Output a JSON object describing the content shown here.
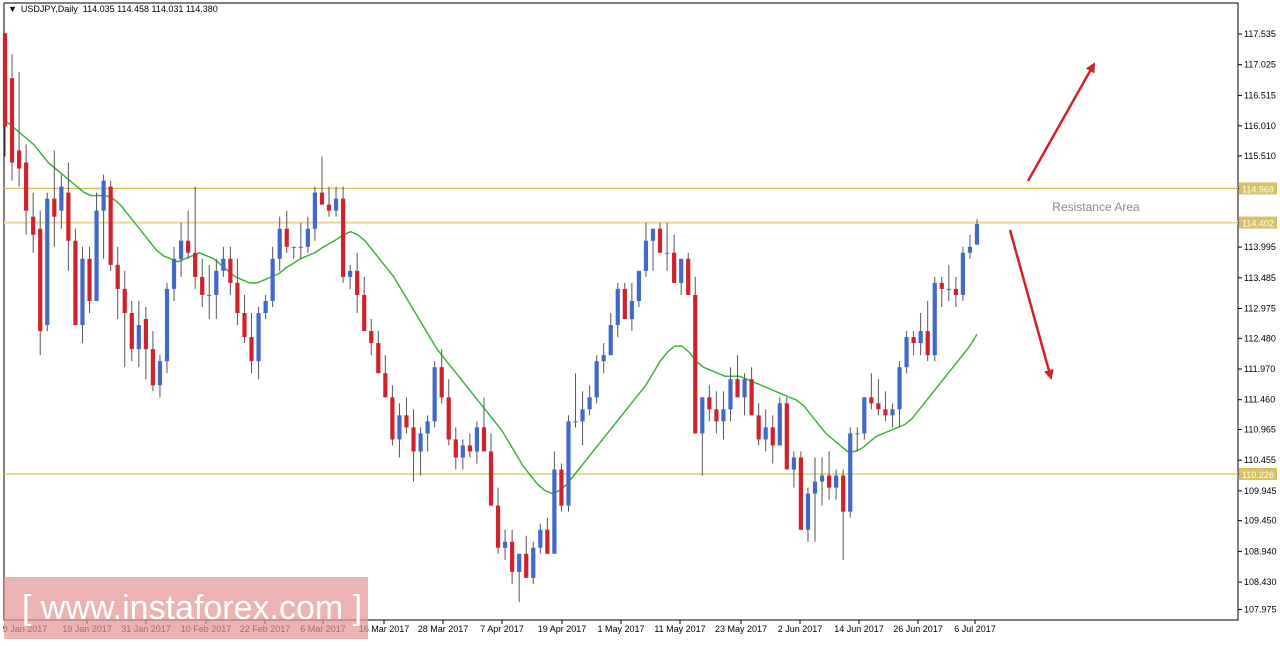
{
  "header": {
    "symbol_timeframe": "USDJPY,Daily",
    "ohlc": "114.035 114.458 114.031 114.380",
    "dropdown_icon": "triangle-down-icon"
  },
  "watermark": "[ www.instaforex.com ]",
  "chart_data": {
    "type": "candlestick",
    "title": "USDJPY,Daily",
    "ylim": [
      107.8,
      118.05
    ],
    "y_ticks": [
      "117.535",
      "117.025",
      "116.515",
      "116.010",
      "115.510",
      "114.969",
      "114.402",
      "113.995",
      "113.485",
      "112.975",
      "112.480",
      "111.970",
      "111.460",
      "110.965",
      "110.455",
      "110.226",
      "109.945",
      "109.450",
      "108.940",
      "108.430",
      "107.975"
    ],
    "x_tick_labels": [
      "9 Jan 2017",
      "19 Jan 2017",
      "31 Jan 2017",
      "10 Feb 2017",
      "22 Feb 2017",
      "6 Mar 2017",
      "16 Mar 2017",
      "28 Mar 2017",
      "7 Apr 2017",
      "19 Apr 2017",
      "1 May 2017",
      "11 May 2017",
      "23 May 2017",
      "2 Jun 2017",
      "14 Jun 2017",
      "26 Jun 2017",
      "6 Jul 2017"
    ],
    "horizontal_levels": [
      {
        "value": 114.969,
        "label": "114.969",
        "color": "#d9c061"
      },
      {
        "value": 114.402,
        "label": "114.402",
        "color": "#d9c061"
      },
      {
        "value": 110.226,
        "label": "110.226",
        "color": "#d9c061"
      }
    ],
    "annotation": {
      "text": "Resistance Area",
      "color": "#8a8a8a"
    },
    "colors": {
      "bull": "#4169c8",
      "bear": "#d0222b",
      "ma": "#3cb43c",
      "arrow": "#d0222b",
      "grid": "#000000"
    },
    "arrows": [
      "up-right",
      "down-right"
    ],
    "candles": [
      {
        "o": 117.55,
        "h": 117.55,
        "l": 115.5,
        "c": 116.0
      },
      {
        "o": 116.8,
        "h": 117.2,
        "l": 115.1,
        "c": 115.4
      },
      {
        "o": 115.6,
        "h": 116.9,
        "l": 115.0,
        "c": 115.3
      },
      {
        "o": 115.4,
        "h": 115.7,
        "l": 114.2,
        "c": 114.6
      },
      {
        "o": 114.5,
        "h": 114.9,
        "l": 113.9,
        "c": 114.2
      },
      {
        "o": 114.3,
        "h": 114.6,
        "l": 112.2,
        "c": 112.6
      },
      {
        "o": 112.7,
        "h": 114.9,
        "l": 112.6,
        "c": 114.8
      },
      {
        "o": 114.8,
        "h": 115.6,
        "l": 114.0,
        "c": 114.5
      },
      {
        "o": 114.6,
        "h": 115.2,
        "l": 114.3,
        "c": 115.0
      },
      {
        "o": 114.9,
        "h": 115.4,
        "l": 113.6,
        "c": 114.1
      },
      {
        "o": 114.1,
        "h": 114.3,
        "l": 112.7,
        "c": 112.7
      },
      {
        "o": 112.7,
        "h": 114.0,
        "l": 112.4,
        "c": 113.8
      },
      {
        "o": 113.8,
        "h": 114.0,
        "l": 112.9,
        "c": 113.1
      },
      {
        "o": 113.1,
        "h": 114.9,
        "l": 113.1,
        "c": 114.6
      },
      {
        "o": 114.6,
        "h": 115.2,
        "l": 113.8,
        "c": 115.1
      },
      {
        "o": 115.0,
        "h": 115.1,
        "l": 113.6,
        "c": 113.7
      },
      {
        "o": 113.7,
        "h": 114.0,
        "l": 112.8,
        "c": 113.3
      },
      {
        "o": 113.3,
        "h": 113.6,
        "l": 112.0,
        "c": 112.9
      },
      {
        "o": 112.9,
        "h": 113.1,
        "l": 112.1,
        "c": 112.3
      },
      {
        "o": 112.3,
        "h": 113.1,
        "l": 112.0,
        "c": 112.7
      },
      {
        "o": 112.8,
        "h": 113.0,
        "l": 111.8,
        "c": 112.3
      },
      {
        "o": 112.3,
        "h": 112.6,
        "l": 111.6,
        "c": 111.7
      },
      {
        "o": 111.7,
        "h": 112.2,
        "l": 111.5,
        "c": 112.1
      },
      {
        "o": 112.1,
        "h": 113.4,
        "l": 111.9,
        "c": 113.3
      },
      {
        "o": 113.3,
        "h": 114.0,
        "l": 113.1,
        "c": 113.8
      },
      {
        "o": 113.8,
        "h": 114.4,
        "l": 113.5,
        "c": 114.1
      },
      {
        "o": 114.1,
        "h": 114.6,
        "l": 113.8,
        "c": 113.9
      },
      {
        "o": 113.9,
        "h": 115.0,
        "l": 113.3,
        "c": 113.5
      },
      {
        "o": 113.5,
        "h": 113.8,
        "l": 113.0,
        "c": 113.2
      },
      {
        "o": 113.2,
        "h": 113.7,
        "l": 112.8,
        "c": 113.2
      },
      {
        "o": 113.2,
        "h": 113.8,
        "l": 112.8,
        "c": 113.6
      },
      {
        "o": 113.6,
        "h": 114.0,
        "l": 113.5,
        "c": 113.8
      },
      {
        "o": 113.8,
        "h": 114.0,
        "l": 113.2,
        "c": 113.4
      },
      {
        "o": 113.4,
        "h": 113.8,
        "l": 112.7,
        "c": 112.9
      },
      {
        "o": 112.9,
        "h": 113.2,
        "l": 112.4,
        "c": 112.5
      },
      {
        "o": 112.5,
        "h": 112.9,
        "l": 111.9,
        "c": 112.1
      },
      {
        "o": 112.1,
        "h": 113.0,
        "l": 111.8,
        "c": 112.9
      },
      {
        "o": 112.9,
        "h": 113.2,
        "l": 112.8,
        "c": 113.1
      },
      {
        "o": 113.1,
        "h": 114.0,
        "l": 113.0,
        "c": 113.8
      },
      {
        "o": 113.8,
        "h": 114.5,
        "l": 113.6,
        "c": 114.3
      },
      {
        "o": 114.3,
        "h": 114.6,
        "l": 113.9,
        "c": 114.0
      },
      {
        "o": 114.0,
        "h": 114.0,
        "l": 113.8,
        "c": 114.0
      },
      {
        "o": 114.0,
        "h": 114.4,
        "l": 113.8,
        "c": 114.0
      },
      {
        "o": 114.0,
        "h": 114.5,
        "l": 113.9,
        "c": 114.3
      },
      {
        "o": 114.3,
        "h": 115.0,
        "l": 114.1,
        "c": 114.9
      },
      {
        "o": 114.9,
        "h": 115.5,
        "l": 114.8,
        "c": 114.7
      },
      {
        "o": 114.7,
        "h": 115.0,
        "l": 114.5,
        "c": 114.6
      },
      {
        "o": 114.6,
        "h": 115.0,
        "l": 114.5,
        "c": 114.8
      },
      {
        "o": 114.8,
        "h": 115.0,
        "l": 113.4,
        "c": 113.5
      },
      {
        "o": 113.5,
        "h": 113.7,
        "l": 113.3,
        "c": 113.6
      },
      {
        "o": 113.6,
        "h": 113.9,
        "l": 112.9,
        "c": 113.2
      },
      {
        "o": 113.2,
        "h": 113.5,
        "l": 112.6,
        "c": 112.6
      },
      {
        "o": 112.6,
        "h": 112.8,
        "l": 112.2,
        "c": 112.4
      },
      {
        "o": 112.4,
        "h": 112.6,
        "l": 111.9,
        "c": 111.9
      },
      {
        "o": 111.9,
        "h": 112.2,
        "l": 111.5,
        "c": 111.5
      },
      {
        "o": 111.5,
        "h": 111.7,
        "l": 110.7,
        "c": 110.8
      },
      {
        "o": 110.8,
        "h": 111.4,
        "l": 110.5,
        "c": 111.2
      },
      {
        "o": 111.2,
        "h": 111.5,
        "l": 110.9,
        "c": 111.0
      },
      {
        "o": 111.0,
        "h": 111.3,
        "l": 110.1,
        "c": 110.6
      },
      {
        "o": 110.6,
        "h": 111.0,
        "l": 110.2,
        "c": 110.9
      },
      {
        "o": 110.9,
        "h": 111.2,
        "l": 110.6,
        "c": 111.1
      },
      {
        "o": 111.1,
        "h": 112.1,
        "l": 111.0,
        "c": 112.0
      },
      {
        "o": 112.0,
        "h": 112.3,
        "l": 111.4,
        "c": 111.5
      },
      {
        "o": 111.5,
        "h": 111.8,
        "l": 110.7,
        "c": 110.8
      },
      {
        "o": 110.8,
        "h": 111.0,
        "l": 110.3,
        "c": 110.5
      },
      {
        "o": 110.5,
        "h": 110.8,
        "l": 110.3,
        "c": 110.7
      },
      {
        "o": 110.7,
        "h": 110.9,
        "l": 110.5,
        "c": 110.6
      },
      {
        "o": 110.6,
        "h": 111.1,
        "l": 110.4,
        "c": 111.0
      },
      {
        "o": 111.0,
        "h": 111.5,
        "l": 110.9,
        "c": 110.6
      },
      {
        "o": 110.6,
        "h": 110.9,
        "l": 109.7,
        "c": 109.7
      },
      {
        "o": 109.7,
        "h": 110.0,
        "l": 108.9,
        "c": 109.0
      },
      {
        "o": 109.0,
        "h": 109.3,
        "l": 108.8,
        "c": 109.1
      },
      {
        "o": 109.1,
        "h": 109.3,
        "l": 108.4,
        "c": 108.6
      },
      {
        "o": 108.6,
        "h": 108.8,
        "l": 108.1,
        "c": 108.9
      },
      {
        "o": 108.9,
        "h": 109.2,
        "l": 108.5,
        "c": 108.5
      },
      {
        "o": 108.5,
        "h": 109.1,
        "l": 108.4,
        "c": 109.0
      },
      {
        "o": 109.0,
        "h": 109.4,
        "l": 108.9,
        "c": 109.3
      },
      {
        "o": 109.3,
        "h": 109.5,
        "l": 108.9,
        "c": 108.9
      },
      {
        "o": 108.9,
        "h": 110.6,
        "l": 108.9,
        "c": 110.3
      },
      {
        "o": 110.3,
        "h": 110.4,
        "l": 109.6,
        "c": 109.7
      },
      {
        "o": 109.7,
        "h": 111.2,
        "l": 109.6,
        "c": 111.1
      },
      {
        "o": 111.1,
        "h": 111.9,
        "l": 111.0,
        "c": 111.1
      },
      {
        "o": 111.1,
        "h": 111.6,
        "l": 110.7,
        "c": 111.3
      },
      {
        "o": 111.3,
        "h": 111.7,
        "l": 111.2,
        "c": 111.5
      },
      {
        "o": 111.5,
        "h": 112.2,
        "l": 111.4,
        "c": 112.1
      },
      {
        "o": 112.1,
        "h": 112.4,
        "l": 111.9,
        "c": 112.2
      },
      {
        "o": 112.2,
        "h": 112.9,
        "l": 112.2,
        "c": 112.7
      },
      {
        "o": 112.7,
        "h": 113.4,
        "l": 112.5,
        "c": 113.3
      },
      {
        "o": 113.3,
        "h": 113.4,
        "l": 112.8,
        "c": 112.8
      },
      {
        "o": 112.8,
        "h": 113.4,
        "l": 112.6,
        "c": 113.1
      },
      {
        "o": 113.1,
        "h": 113.6,
        "l": 113.0,
        "c": 113.6
      },
      {
        "o": 113.6,
        "h": 114.4,
        "l": 113.5,
        "c": 114.1
      },
      {
        "o": 114.1,
        "h": 114.3,
        "l": 113.6,
        "c": 114.3
      },
      {
        "o": 114.3,
        "h": 114.4,
        "l": 113.9,
        "c": 113.9
      },
      {
        "o": 113.9,
        "h": 114.4,
        "l": 113.6,
        "c": 113.9
      },
      {
        "o": 113.9,
        "h": 114.2,
        "l": 113.4,
        "c": 113.4
      },
      {
        "o": 113.4,
        "h": 113.8,
        "l": 113.2,
        "c": 113.8
      },
      {
        "o": 113.8,
        "h": 113.9,
        "l": 113.2,
        "c": 113.2
      },
      {
        "o": 113.2,
        "h": 113.5,
        "l": 110.9,
        "c": 110.9
      },
      {
        "o": 110.9,
        "h": 111.5,
        "l": 110.2,
        "c": 111.5
      },
      {
        "o": 111.5,
        "h": 111.7,
        "l": 111.1,
        "c": 111.3
      },
      {
        "o": 111.3,
        "h": 111.6,
        "l": 110.9,
        "c": 111.1
      },
      {
        "o": 111.1,
        "h": 111.6,
        "l": 110.8,
        "c": 111.3
      },
      {
        "o": 111.3,
        "h": 112.0,
        "l": 111.1,
        "c": 111.8
      },
      {
        "o": 111.8,
        "h": 112.2,
        "l": 111.5,
        "c": 111.5
      },
      {
        "o": 111.5,
        "h": 111.9,
        "l": 111.2,
        "c": 111.8
      },
      {
        "o": 111.8,
        "h": 112.0,
        "l": 111.2,
        "c": 111.2
      },
      {
        "o": 111.2,
        "h": 111.4,
        "l": 110.7,
        "c": 110.8
      },
      {
        "o": 110.8,
        "h": 111.3,
        "l": 110.6,
        "c": 111.0
      },
      {
        "o": 111.0,
        "h": 111.2,
        "l": 110.4,
        "c": 110.7
      },
      {
        "o": 110.7,
        "h": 111.5,
        "l": 110.7,
        "c": 111.4
      },
      {
        "o": 111.4,
        "h": 111.5,
        "l": 110.3,
        "c": 110.3
      },
      {
        "o": 110.3,
        "h": 110.6,
        "l": 110.0,
        "c": 110.5
      },
      {
        "o": 110.5,
        "h": 110.6,
        "l": 109.3,
        "c": 109.3
      },
      {
        "o": 109.3,
        "h": 110.0,
        "l": 109.1,
        "c": 109.9
      },
      {
        "o": 109.9,
        "h": 110.5,
        "l": 109.1,
        "c": 110.1
      },
      {
        "o": 110.1,
        "h": 110.5,
        "l": 109.7,
        "c": 110.2
      },
      {
        "o": 110.2,
        "h": 110.6,
        "l": 109.8,
        "c": 110.0
      },
      {
        "o": 110.0,
        "h": 110.3,
        "l": 109.8,
        "c": 110.2
      },
      {
        "o": 110.2,
        "h": 110.3,
        "l": 108.8,
        "c": 109.6
      },
      {
        "o": 109.6,
        "h": 111.0,
        "l": 109.5,
        "c": 110.9
      },
      {
        "o": 110.9,
        "h": 111.0,
        "l": 110.6,
        "c": 110.9
      },
      {
        "o": 110.9,
        "h": 111.5,
        "l": 110.8,
        "c": 111.5
      },
      {
        "o": 111.5,
        "h": 111.9,
        "l": 111.3,
        "c": 111.4
      },
      {
        "o": 111.4,
        "h": 111.8,
        "l": 111.2,
        "c": 111.3
      },
      {
        "o": 111.3,
        "h": 111.6,
        "l": 111.1,
        "c": 111.2
      },
      {
        "o": 111.2,
        "h": 111.4,
        "l": 111.0,
        "c": 111.3
      },
      {
        "o": 111.3,
        "h": 112.1,
        "l": 111.0,
        "c": 112.0
      },
      {
        "o": 112.0,
        "h": 112.6,
        "l": 111.9,
        "c": 112.5
      },
      {
        "o": 112.5,
        "h": 112.6,
        "l": 112.2,
        "c": 112.4
      },
      {
        "o": 112.4,
        "h": 112.9,
        "l": 112.2,
        "c": 112.6
      },
      {
        "o": 112.6,
        "h": 113.1,
        "l": 112.1,
        "c": 112.2
      },
      {
        "o": 112.2,
        "h": 113.5,
        "l": 112.1,
        "c": 113.4
      },
      {
        "o": 113.4,
        "h": 113.5,
        "l": 113.0,
        "c": 113.3
      },
      {
        "o": 113.3,
        "h": 113.7,
        "l": 113.1,
        "c": 113.3
      },
      {
        "o": 113.3,
        "h": 113.5,
        "l": 113.0,
        "c": 113.2
      },
      {
        "o": 113.2,
        "h": 114.0,
        "l": 113.1,
        "c": 113.9
      },
      {
        "o": 113.9,
        "h": 114.2,
        "l": 113.8,
        "c": 114.0
      },
      {
        "o": 114.035,
        "h": 114.458,
        "l": 114.031,
        "c": 114.38
      }
    ],
    "ma_values": [
      116.1,
      116.0,
      115.9,
      115.8,
      115.7,
      115.55,
      115.4,
      115.3,
      115.2,
      115.1,
      115.0,
      114.9,
      114.85,
      114.85,
      114.85,
      114.8,
      114.7,
      114.55,
      114.4,
      114.25,
      114.1,
      113.95,
      113.85,
      113.8,
      113.75,
      113.8,
      113.85,
      113.9,
      113.85,
      113.8,
      113.7,
      113.6,
      113.5,
      113.45,
      113.4,
      113.4,
      113.45,
      113.5,
      113.55,
      113.65,
      113.72,
      113.8,
      113.85,
      113.9,
      113.98,
      114.05,
      114.12,
      114.2,
      114.25,
      114.2,
      114.1,
      113.95,
      113.8,
      113.65,
      113.5,
      113.3,
      113.1,
      112.9,
      112.7,
      112.5,
      112.3,
      112.15,
      112.0,
      111.85,
      111.7,
      111.55,
      111.4,
      111.25,
      111.1,
      110.95,
      110.75,
      110.55,
      110.35,
      110.2,
      110.05,
      109.95,
      109.9,
      109.95,
      110.05,
      110.2,
      110.35,
      110.5,
      110.65,
      110.8,
      110.95,
      111.1,
      111.25,
      111.4,
      111.55,
      111.7,
      111.9,
      112.1,
      112.25,
      112.35,
      112.35,
      112.25,
      112.1,
      112.0,
      111.95,
      111.9,
      111.85,
      111.85,
      111.85,
      111.8,
      111.75,
      111.7,
      111.65,
      111.6,
      111.55,
      111.5,
      111.45,
      111.35,
      111.2,
      111.05,
      110.9,
      110.8,
      110.7,
      110.6,
      110.6,
      110.65,
      110.75,
      110.85,
      110.9,
      110.95,
      111.0,
      111.05,
      111.15,
      111.3,
      111.45,
      111.6,
      111.75,
      111.9,
      112.05,
      112.2,
      112.35,
      112.55
    ]
  }
}
